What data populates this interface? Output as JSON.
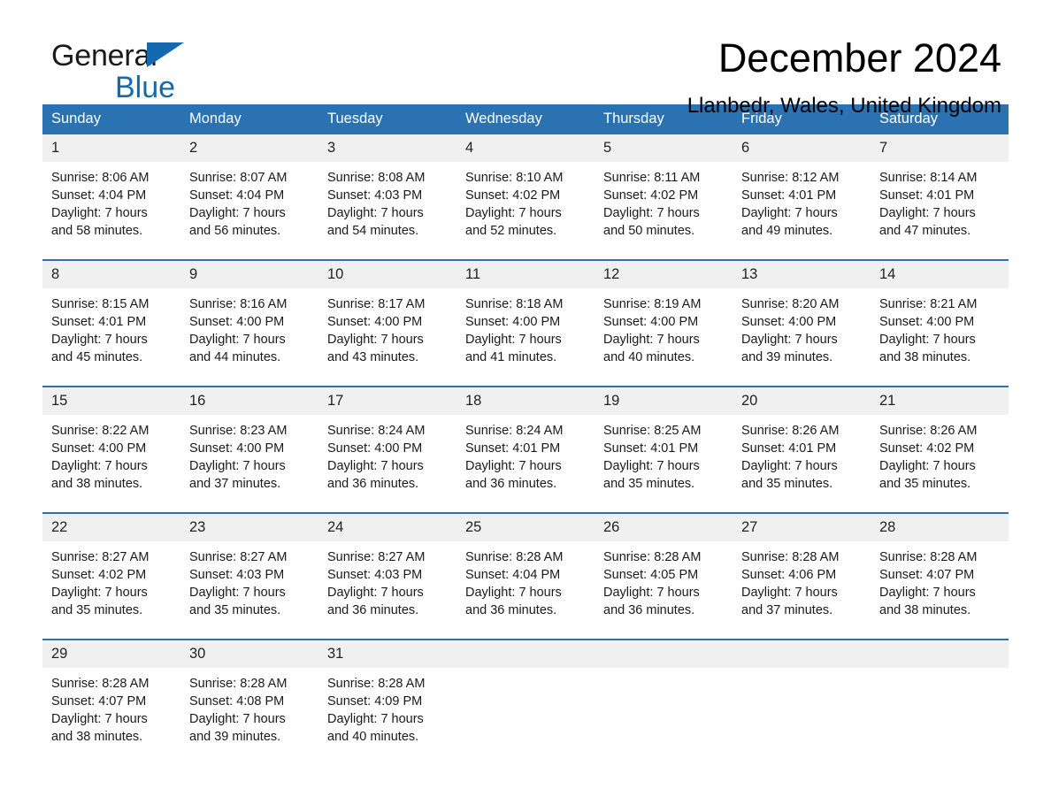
{
  "brand": {
    "logo_line1": "General",
    "logo_line2": "Blue",
    "accent_color": "#1569b0"
  },
  "header": {
    "month_title": "December 2024",
    "location": "Llanbedr, Wales, United Kingdom",
    "header_bg_color": "#2b72b3",
    "daynum_bg_color": "#f0f0f0"
  },
  "calendar": {
    "weekday_headers": [
      "Sunday",
      "Monday",
      "Tuesday",
      "Wednesday",
      "Thursday",
      "Friday",
      "Saturday"
    ],
    "weeks": [
      [
        {
          "day": "1",
          "sunrise": "Sunrise: 8:06 AM",
          "sunset": "Sunset: 4:04 PM",
          "daylight_line1": "Daylight: 7 hours",
          "daylight_line2": "and 58 minutes."
        },
        {
          "day": "2",
          "sunrise": "Sunrise: 8:07 AM",
          "sunset": "Sunset: 4:04 PM",
          "daylight_line1": "Daylight: 7 hours",
          "daylight_line2": "and 56 minutes."
        },
        {
          "day": "3",
          "sunrise": "Sunrise: 8:08 AM",
          "sunset": "Sunset: 4:03 PM",
          "daylight_line1": "Daylight: 7 hours",
          "daylight_line2": "and 54 minutes."
        },
        {
          "day": "4",
          "sunrise": "Sunrise: 8:10 AM",
          "sunset": "Sunset: 4:02 PM",
          "daylight_line1": "Daylight: 7 hours",
          "daylight_line2": "and 52 minutes."
        },
        {
          "day": "5",
          "sunrise": "Sunrise: 8:11 AM",
          "sunset": "Sunset: 4:02 PM",
          "daylight_line1": "Daylight: 7 hours",
          "daylight_line2": "and 50 minutes."
        },
        {
          "day": "6",
          "sunrise": "Sunrise: 8:12 AM",
          "sunset": "Sunset: 4:01 PM",
          "daylight_line1": "Daylight: 7 hours",
          "daylight_line2": "and 49 minutes."
        },
        {
          "day": "7",
          "sunrise": "Sunrise: 8:14 AM",
          "sunset": "Sunset: 4:01 PM",
          "daylight_line1": "Daylight: 7 hours",
          "daylight_line2": "and 47 minutes."
        }
      ],
      [
        {
          "day": "8",
          "sunrise": "Sunrise: 8:15 AM",
          "sunset": "Sunset: 4:01 PM",
          "daylight_line1": "Daylight: 7 hours",
          "daylight_line2": "and 45 minutes."
        },
        {
          "day": "9",
          "sunrise": "Sunrise: 8:16 AM",
          "sunset": "Sunset: 4:00 PM",
          "daylight_line1": "Daylight: 7 hours",
          "daylight_line2": "and 44 minutes."
        },
        {
          "day": "10",
          "sunrise": "Sunrise: 8:17 AM",
          "sunset": "Sunset: 4:00 PM",
          "daylight_line1": "Daylight: 7 hours",
          "daylight_line2": "and 43 minutes."
        },
        {
          "day": "11",
          "sunrise": "Sunrise: 8:18 AM",
          "sunset": "Sunset: 4:00 PM",
          "daylight_line1": "Daylight: 7 hours",
          "daylight_line2": "and 41 minutes."
        },
        {
          "day": "12",
          "sunrise": "Sunrise: 8:19 AM",
          "sunset": "Sunset: 4:00 PM",
          "daylight_line1": "Daylight: 7 hours",
          "daylight_line2": "and 40 minutes."
        },
        {
          "day": "13",
          "sunrise": "Sunrise: 8:20 AM",
          "sunset": "Sunset: 4:00 PM",
          "daylight_line1": "Daylight: 7 hours",
          "daylight_line2": "and 39 minutes."
        },
        {
          "day": "14",
          "sunrise": "Sunrise: 8:21 AM",
          "sunset": "Sunset: 4:00 PM",
          "daylight_line1": "Daylight: 7 hours",
          "daylight_line2": "and 38 minutes."
        }
      ],
      [
        {
          "day": "15",
          "sunrise": "Sunrise: 8:22 AM",
          "sunset": "Sunset: 4:00 PM",
          "daylight_line1": "Daylight: 7 hours",
          "daylight_line2": "and 38 minutes."
        },
        {
          "day": "16",
          "sunrise": "Sunrise: 8:23 AM",
          "sunset": "Sunset: 4:00 PM",
          "daylight_line1": "Daylight: 7 hours",
          "daylight_line2": "and 37 minutes."
        },
        {
          "day": "17",
          "sunrise": "Sunrise: 8:24 AM",
          "sunset": "Sunset: 4:00 PM",
          "daylight_line1": "Daylight: 7 hours",
          "daylight_line2": "and 36 minutes."
        },
        {
          "day": "18",
          "sunrise": "Sunrise: 8:24 AM",
          "sunset": "Sunset: 4:01 PM",
          "daylight_line1": "Daylight: 7 hours",
          "daylight_line2": "and 36 minutes."
        },
        {
          "day": "19",
          "sunrise": "Sunrise: 8:25 AM",
          "sunset": "Sunset: 4:01 PM",
          "daylight_line1": "Daylight: 7 hours",
          "daylight_line2": "and 35 minutes."
        },
        {
          "day": "20",
          "sunrise": "Sunrise: 8:26 AM",
          "sunset": "Sunset: 4:01 PM",
          "daylight_line1": "Daylight: 7 hours",
          "daylight_line2": "and 35 minutes."
        },
        {
          "day": "21",
          "sunrise": "Sunrise: 8:26 AM",
          "sunset": "Sunset: 4:02 PM",
          "daylight_line1": "Daylight: 7 hours",
          "daylight_line2": "and 35 minutes."
        }
      ],
      [
        {
          "day": "22",
          "sunrise": "Sunrise: 8:27 AM",
          "sunset": "Sunset: 4:02 PM",
          "daylight_line1": "Daylight: 7 hours",
          "daylight_line2": "and 35 minutes."
        },
        {
          "day": "23",
          "sunrise": "Sunrise: 8:27 AM",
          "sunset": "Sunset: 4:03 PM",
          "daylight_line1": "Daylight: 7 hours",
          "daylight_line2": "and 35 minutes."
        },
        {
          "day": "24",
          "sunrise": "Sunrise: 8:27 AM",
          "sunset": "Sunset: 4:03 PM",
          "daylight_line1": "Daylight: 7 hours",
          "daylight_line2": "and 36 minutes."
        },
        {
          "day": "25",
          "sunrise": "Sunrise: 8:28 AM",
          "sunset": "Sunset: 4:04 PM",
          "daylight_line1": "Daylight: 7 hours",
          "daylight_line2": "and 36 minutes."
        },
        {
          "day": "26",
          "sunrise": "Sunrise: 8:28 AM",
          "sunset": "Sunset: 4:05 PM",
          "daylight_line1": "Daylight: 7 hours",
          "daylight_line2": "and 36 minutes."
        },
        {
          "day": "27",
          "sunrise": "Sunrise: 8:28 AM",
          "sunset": "Sunset: 4:06 PM",
          "daylight_line1": "Daylight: 7 hours",
          "daylight_line2": "and 37 minutes."
        },
        {
          "day": "28",
          "sunrise": "Sunrise: 8:28 AM",
          "sunset": "Sunset: 4:07 PM",
          "daylight_line1": "Daylight: 7 hours",
          "daylight_line2": "and 38 minutes."
        }
      ],
      [
        {
          "day": "29",
          "sunrise": "Sunrise: 8:28 AM",
          "sunset": "Sunset: 4:07 PM",
          "daylight_line1": "Daylight: 7 hours",
          "daylight_line2": "and 38 minutes."
        },
        {
          "day": "30",
          "sunrise": "Sunrise: 8:28 AM",
          "sunset": "Sunset: 4:08 PM",
          "daylight_line1": "Daylight: 7 hours",
          "daylight_line2": "and 39 minutes."
        },
        {
          "day": "31",
          "sunrise": "Sunrise: 8:28 AM",
          "sunset": "Sunset: 4:09 PM",
          "daylight_line1": "Daylight: 7 hours",
          "daylight_line2": "and 40 minutes."
        },
        {
          "day": "",
          "sunrise": "",
          "sunset": "",
          "daylight_line1": "",
          "daylight_line2": ""
        },
        {
          "day": "",
          "sunrise": "",
          "sunset": "",
          "daylight_line1": "",
          "daylight_line2": ""
        },
        {
          "day": "",
          "sunrise": "",
          "sunset": "",
          "daylight_line1": "",
          "daylight_line2": ""
        },
        {
          "day": "",
          "sunrise": "",
          "sunset": "",
          "daylight_line1": "",
          "daylight_line2": ""
        }
      ]
    ]
  }
}
